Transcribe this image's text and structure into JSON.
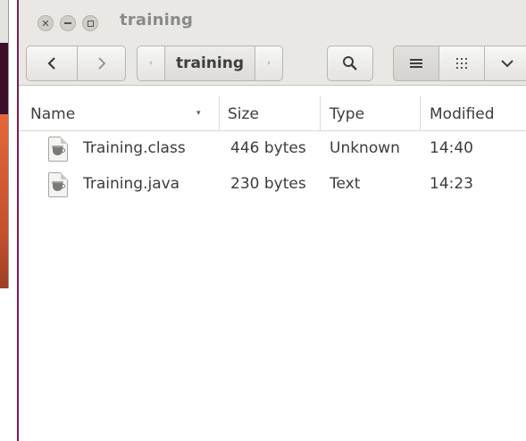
{
  "window": {
    "title": "training"
  },
  "toolbar": {
    "back_label": "<",
    "forward_label": ">",
    "path_left_arrow": "‹",
    "path_current": "training",
    "path_right_arrow": "›",
    "search_icon": "search-icon",
    "list_view_icon": "list-view-icon",
    "grid_view_icon": "grid-view-icon",
    "more_icon": "chevron-down-icon"
  },
  "columns": {
    "name": "Name",
    "sort_indicator": "▾",
    "size": "Size",
    "type": "Type",
    "modified": "Modified"
  },
  "files": [
    {
      "name": "Training.class",
      "size": "446 bytes",
      "type": "Unknown",
      "modified": "14:40",
      "icon": "java-file-icon"
    },
    {
      "name": "Training.java",
      "size": "230 bytes",
      "type": "Text",
      "modified": "14:23",
      "icon": "java-file-icon"
    }
  ],
  "colors": {
    "titlebar": "#e9e8e5",
    "desktop_accent": "#7a1f4c",
    "prev_window_orange": "#e4673a"
  }
}
